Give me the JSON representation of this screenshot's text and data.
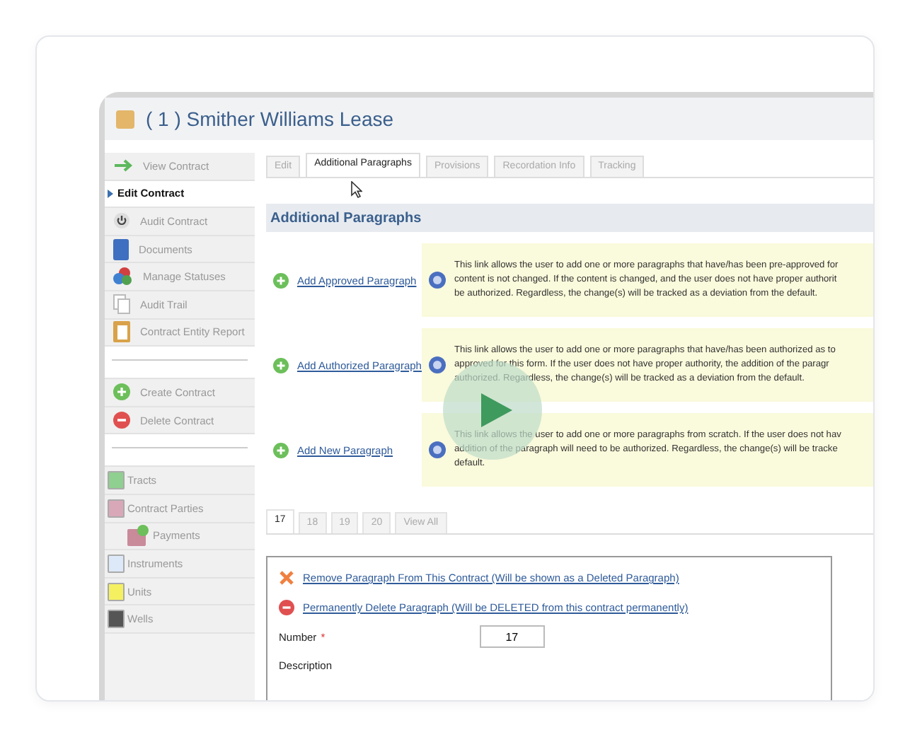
{
  "window": {
    "title": "( 1 ) Smither Williams Lease"
  },
  "sidebar": {
    "groups": [
      {
        "items": [
          {
            "label": "View Contract",
            "kind": "arrow",
            "selected": false
          },
          {
            "label": "Edit Contract",
            "kind": "none",
            "selected": true
          },
          {
            "label": "Audit Contract",
            "kind": "power",
            "selected": false
          },
          {
            "label": "Documents",
            "kind": "book",
            "selected": false
          },
          {
            "label": "Manage Statuses",
            "kind": "balls",
            "selected": false
          },
          {
            "label": "Audit Trail",
            "kind": "pages",
            "selected": false
          },
          {
            "label": "Contract Entity Report",
            "kind": "report",
            "selected": false
          }
        ]
      },
      {
        "items": [
          {
            "label": "Create Contract",
            "kind": "plus",
            "selected": false
          },
          {
            "label": "Delete Contract",
            "kind": "minus",
            "selected": false
          }
        ]
      },
      {
        "items": [
          {
            "label": "Tracts",
            "kind": "swatch",
            "color": "#8fcf8f",
            "selected": false
          },
          {
            "label": "Contract Parties",
            "kind": "swatch",
            "color": "#d9a8b8",
            "selected": false,
            "children": [
              {
                "label": "Payments",
                "kind": "money",
                "selected": false
              }
            ]
          },
          {
            "label": "Instruments",
            "kind": "swatch",
            "color": "#dde8f8",
            "selected": false
          },
          {
            "label": "Units",
            "kind": "swatch",
            "color": "#f5f060",
            "selected": false
          },
          {
            "label": "Wells",
            "kind": "swatch",
            "color": "#555555",
            "selected": false
          }
        ]
      }
    ]
  },
  "tabs": [
    {
      "label": "Edit",
      "selected": false
    },
    {
      "label": "Additional Paragraphs",
      "selected": true
    },
    {
      "label": "Provisions",
      "selected": false
    },
    {
      "label": "Recordation Info",
      "selected": false
    },
    {
      "label": "Tracking",
      "selected": false
    }
  ],
  "section_title": "Additional Paragraphs",
  "actions": [
    {
      "link": "Add Approved Paragraph",
      "info": [
        "This link allows the user to add one or more paragraphs that have/has been pre-approved for",
        "content is not changed. If the content is changed, and the user does not have proper authorit",
        "be authorized. Regardless, the change(s) will be tracked as a deviation from the default."
      ]
    },
    {
      "link": "Add Authorized Paragraph",
      "info": [
        "This link allows the user to add one or more paragraphs that have/has been authorized as to",
        "approved for this form. If the user does not have proper authority, the addition of the paragr",
        "authorized. Regardless, the change(s) will be tracked as a deviation from the default."
      ]
    },
    {
      "link": "Add New Paragraph",
      "info": [
        "This link allows the user to add one or more paragraphs from scratch. If the user does not hav",
        "addition of the paragraph will need to be authorized. Regardless, the change(s) will be tracke",
        "default."
      ]
    }
  ],
  "paragraph_tabs": [
    {
      "label": "17",
      "selected": true
    },
    {
      "label": "18",
      "selected": false
    },
    {
      "label": "19",
      "selected": false
    },
    {
      "label": "20",
      "selected": false
    },
    {
      "label": "View All",
      "selected": false
    }
  ],
  "panel": {
    "links": [
      {
        "label": "Remove Paragraph From This Contract (Will be shown as a Deleted Paragraph)",
        "kind": "remove"
      },
      {
        "label": "Permanently Delete Paragraph (Will be DELETED from this contract permanently)",
        "kind": "delete"
      }
    ],
    "number": {
      "label": "Number",
      "required_mark": "*",
      "value": "17"
    },
    "description_label": "Description"
  }
}
